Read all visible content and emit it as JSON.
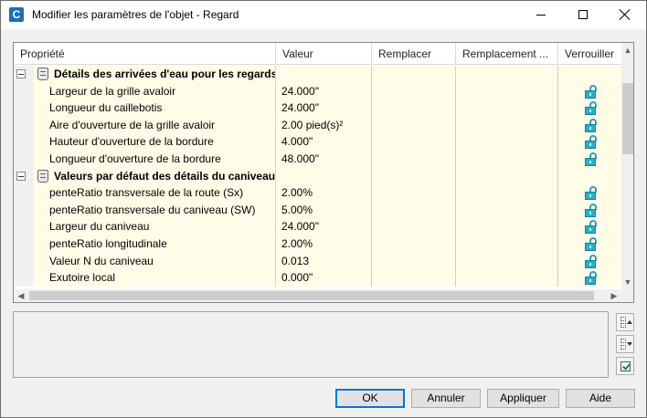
{
  "window": {
    "title": "Modifier les paramètres de l'objet - Regard",
    "app_icon": "civil3d-icon"
  },
  "grid": {
    "columns": [
      "Propriété",
      "Valeur",
      "Remplacer",
      "Remplacement ...",
      "Verrouiller"
    ],
    "rows": [
      {
        "type": "category",
        "label": "Détails des arrivées d'eau pour les regards...",
        "value": ""
      },
      {
        "type": "item",
        "label": "Largeur de la grille avaloir",
        "value": "24.000\"",
        "locked": true
      },
      {
        "type": "item",
        "label": "Longueur du caillebotis",
        "value": "24.000\"",
        "locked": true
      },
      {
        "type": "item",
        "label": "Aire d'ouverture de la grille avaloir",
        "value": "2.00 pied(s)²",
        "locked": true
      },
      {
        "type": "item",
        "label": "Hauteur d'ouverture de la bordure",
        "value": "4.000\"",
        "locked": true
      },
      {
        "type": "item",
        "label": "Longueur d'ouverture de la bordure",
        "value": "48.000\"",
        "locked": true
      },
      {
        "type": "category",
        "label": "Valeurs par défaut des détails du caniveau",
        "value": ""
      },
      {
        "type": "item",
        "label": "penteRatio transversale de la route (Sx)",
        "value": "2.00%",
        "locked": true
      },
      {
        "type": "item",
        "label": "penteRatio transversale du caniveau (SW)",
        "value": "5.00%",
        "locked": true
      },
      {
        "type": "item",
        "label": "Largeur du caniveau",
        "value": "24.000\"",
        "locked": true
      },
      {
        "type": "item",
        "label": "penteRatio longitudinale",
        "value": "2.00%",
        "locked": true
      },
      {
        "type": "item",
        "label": "Valeur N du caniveau",
        "value": "0.013",
        "locked": true
      },
      {
        "type": "item",
        "label": "Exutoire local",
        "value": "0.000\"",
        "locked": true
      }
    ]
  },
  "buttons": {
    "ok": "OK",
    "cancel": "Annuler",
    "apply": "Appliquer",
    "help": "Aide"
  },
  "colors": {
    "row_background": "#fffde7",
    "lock_icon": "#2ab0c8",
    "default_button_border": "#0078d7"
  }
}
